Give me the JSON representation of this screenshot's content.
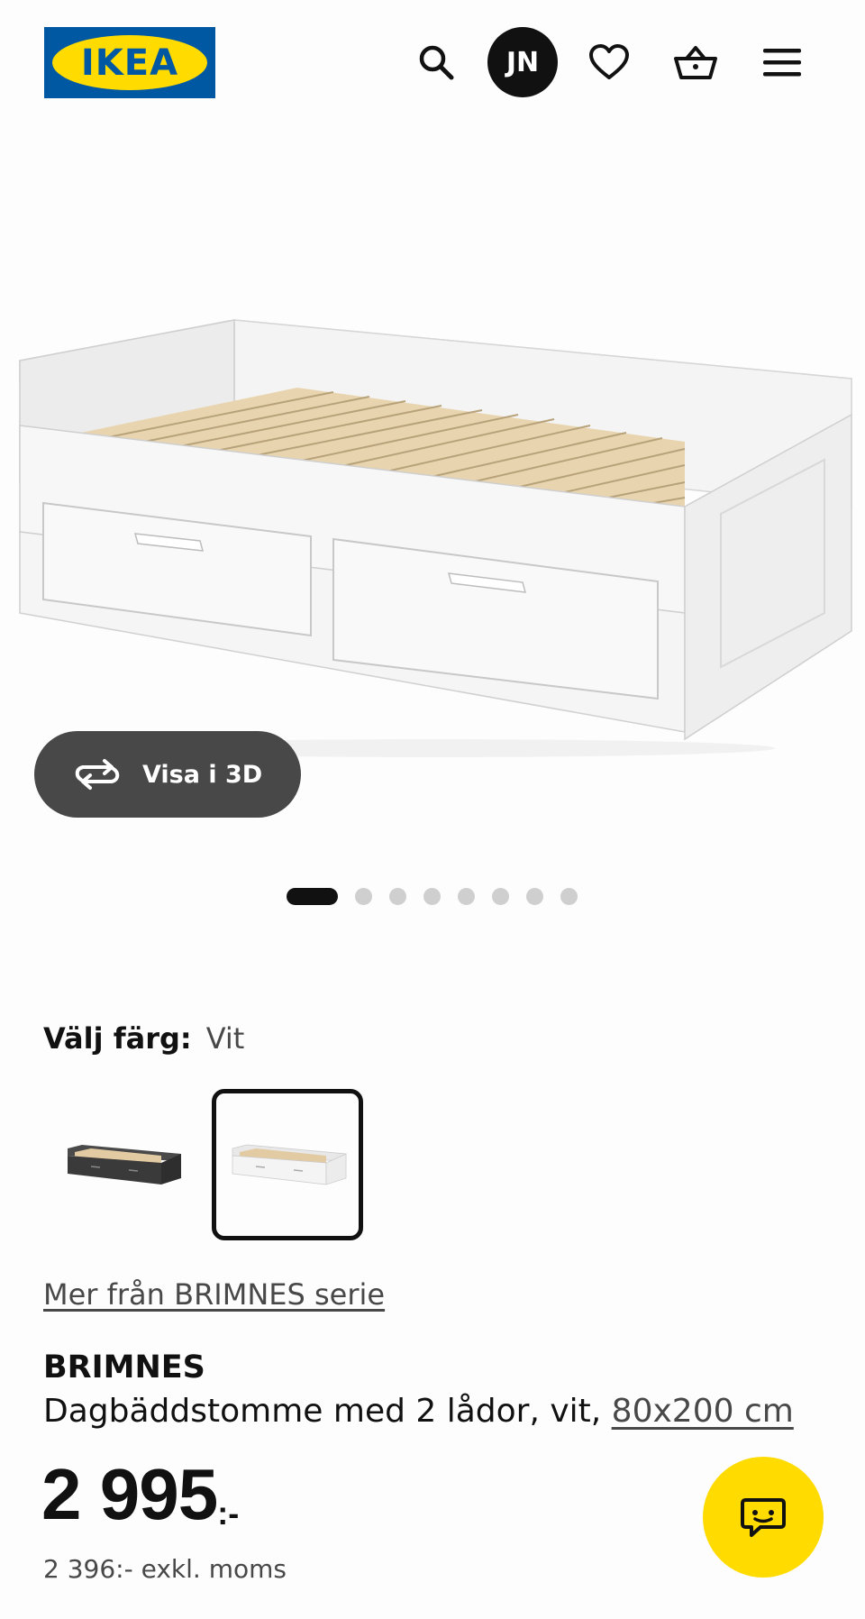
{
  "header": {
    "logo_text": "IKEA",
    "avatar_initials": "JN",
    "icons": [
      "search-icon",
      "heart-icon",
      "basket-icon",
      "menu-icon"
    ]
  },
  "gallery": {
    "view_3d_label": "Visa i 3D",
    "slide_count": 8,
    "active_slide": 1
  },
  "color_selector": {
    "label": "Välj färg:",
    "selected_value": "Vit",
    "options": [
      "black-brown",
      "white"
    ],
    "selected_index": 1
  },
  "series_link": "Mer från BRIMNES serie",
  "product": {
    "brand": "BRIMNES",
    "description": "Dagbäddstomme med 2 lådor, vit, ",
    "dimension": "80x200 cm",
    "price": "2 995",
    "price_suffix": ":-",
    "price_excl_vat": "2 396:- exkl. moms"
  },
  "colors": {
    "ikea_blue": "#0058a3",
    "ikea_yellow": "#ffdb00",
    "dark_button": "#484848"
  }
}
